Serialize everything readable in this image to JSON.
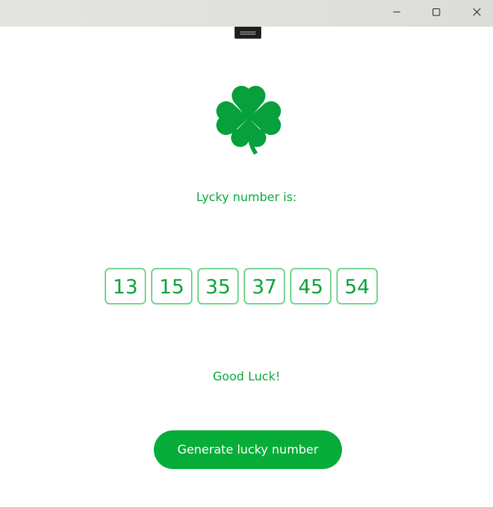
{
  "window": {
    "controls": {
      "minimize_icon": "minimize-icon",
      "maximize_icon": "maximize-icon",
      "close_icon": "close-icon"
    }
  },
  "colors": {
    "accent": "#08ac38",
    "text_green": "#0aaa3a",
    "box_border": "#6fd38a",
    "clover": "#06a03c"
  },
  "header": {
    "icon": "four-leaf-clover-icon",
    "label": "Lycky number is:"
  },
  "numbers": [
    "13",
    "15",
    "35",
    "37",
    "45",
    "54"
  ],
  "footer_message": "Good Luck!",
  "action": {
    "generate_label": "Generate lucky number"
  }
}
